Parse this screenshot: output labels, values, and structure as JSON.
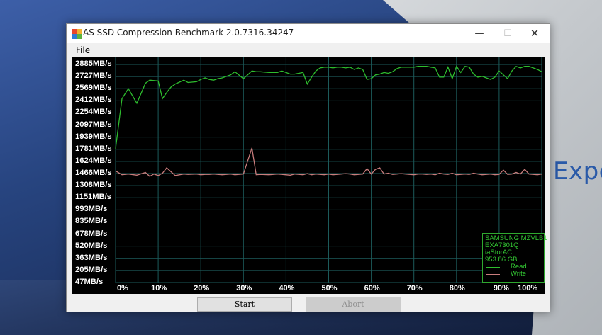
{
  "window": {
    "title": "AS SSD Compression-Benchmark 2.0.7316.34247",
    "minimize_glyph": "—",
    "maximize_glyph": "☐",
    "close_glyph": "✕"
  },
  "menu": {
    "file": "File"
  },
  "background": {
    "wall_text": "Expe"
  },
  "colors": {
    "read": "#2ebd2e",
    "write": "#c97d7d",
    "grid": "#1c5a5a",
    "legend_text": "#33c933"
  },
  "chart_data": {
    "type": "line",
    "y_unit": "MB/s",
    "y_tick_labels": [
      "2885MB/s",
      "2727MB/s",
      "2569MB/s",
      "2412MB/s",
      "2254MB/s",
      "2097MB/s",
      "1939MB/s",
      "1781MB/s",
      "1624MB/s",
      "1466MB/s",
      "1308MB/s",
      "1151MB/s",
      "993MB/s",
      "835MB/s",
      "678MB/s",
      "520MB/s",
      "363MB/s",
      "205MB/s",
      "47MB/s"
    ],
    "x_tick_labels": [
      "0%",
      "10%",
      "20%",
      "30%",
      "40%",
      "50%",
      "60%",
      "70%",
      "80%",
      "90%",
      "100%"
    ],
    "ylim": [
      47,
      2885
    ],
    "xlim": [
      0,
      100
    ],
    "legend": {
      "device": "SAMSUNG MZVLB1",
      "firmware": "EXA7301Q",
      "driver": "iaStorAC",
      "capacity": "953.86 GB",
      "position": "bottom-right"
    },
    "series": [
      {
        "name": "Read",
        "x": [
          0,
          1.5,
          3,
          5,
          7,
          8,
          10,
          11,
          12,
          13,
          14,
          16,
          17,
          19,
          20,
          21,
          22,
          23,
          24,
          25,
          27,
          28,
          30,
          32,
          33,
          34,
          36,
          38,
          39,
          41,
          42,
          44,
          45,
          46,
          47,
          48,
          49,
          50,
          51,
          52,
          53,
          54,
          55,
          56,
          57,
          58,
          59,
          60,
          61,
          62,
          63,
          64,
          65,
          66,
          67,
          68,
          69,
          70,
          71,
          72,
          73,
          74,
          75,
          76,
          77,
          78,
          79,
          80,
          81,
          82,
          83,
          84,
          85,
          86,
          87,
          88,
          89,
          90,
          91,
          92,
          93,
          94,
          95,
          96,
          97,
          98,
          99,
          100
        ],
        "y": [
          1790,
          2440,
          2570,
          2380,
          2640,
          2680,
          2670,
          2440,
          2520,
          2590,
          2630,
          2680,
          2650,
          2660,
          2690,
          2710,
          2690,
          2680,
          2700,
          2710,
          2750,
          2790,
          2700,
          2800,
          2790,
          2790,
          2780,
          2780,
          2800,
          2760,
          2760,
          2780,
          2630,
          2720,
          2800,
          2840,
          2850,
          2850,
          2840,
          2850,
          2850,
          2840,
          2850,
          2820,
          2840,
          2820,
          2690,
          2700,
          2750,
          2760,
          2780,
          2770,
          2790,
          2830,
          2850,
          2850,
          2850,
          2850,
          2860,
          2860,
          2860,
          2850,
          2840,
          2720,
          2720,
          2850,
          2700,
          2860,
          2780,
          2860,
          2850,
          2760,
          2720,
          2730,
          2710,
          2690,
          2720,
          2800,
          2750,
          2700,
          2800,
          2860,
          2840,
          2860,
          2860,
          2840,
          2820,
          2790
        ]
      },
      {
        "name": "Write",
        "x": [
          0,
          1.5,
          3,
          5,
          7,
          8,
          9,
          10,
          11,
          12,
          14,
          16,
          17,
          19,
          20,
          21,
          22,
          23,
          24,
          25,
          27,
          28,
          30,
          32,
          33,
          34,
          36,
          38,
          39,
          41,
          42,
          44,
          45,
          46,
          47,
          48,
          49,
          50,
          51,
          52,
          53,
          54,
          55,
          56,
          57,
          58,
          59,
          60,
          61,
          62,
          63,
          64,
          65,
          66,
          67,
          68,
          69,
          70,
          71,
          72,
          73,
          74,
          75,
          76,
          77,
          78,
          79,
          80,
          81,
          82,
          83,
          84,
          85,
          86,
          87,
          88,
          89,
          90,
          91,
          92,
          93,
          94,
          95,
          96,
          97,
          98,
          99,
          100
        ],
        "y": [
          1500,
          1450,
          1460,
          1445,
          1480,
          1430,
          1460,
          1440,
          1470,
          1540,
          1440,
          1460,
          1455,
          1460,
          1450,
          1455,
          1455,
          1460,
          1455,
          1450,
          1460,
          1450,
          1460,
          1800,
          1450,
          1455,
          1450,
          1460,
          1455,
          1445,
          1460,
          1450,
          1465,
          1450,
          1460,
          1455,
          1450,
          1460,
          1450,
          1455,
          1460,
          1465,
          1460,
          1450,
          1455,
          1460,
          1530,
          1460,
          1520,
          1540,
          1460,
          1470,
          1455,
          1460,
          1465,
          1460,
          1455,
          1450,
          1460,
          1460,
          1455,
          1460,
          1450,
          1470,
          1460,
          1455,
          1470,
          1450,
          1455,
          1460,
          1455,
          1470,
          1460,
          1450,
          1455,
          1460,
          1450,
          1455,
          1510,
          1455,
          1460,
          1480,
          1460,
          1520,
          1460,
          1455,
          1450,
          1460
        ]
      }
    ]
  },
  "buttons": {
    "start": "Start",
    "abort": "Abort"
  }
}
